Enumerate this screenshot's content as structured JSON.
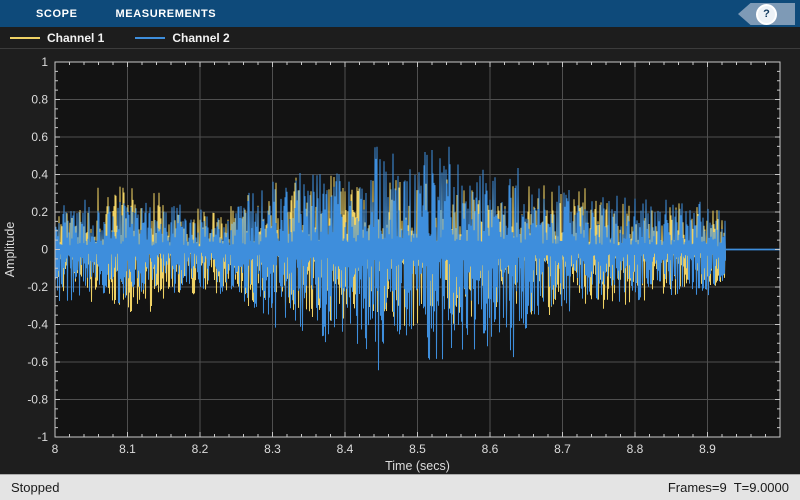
{
  "tab_bar": {
    "tabs": [
      {
        "label": "SCOPE"
      },
      {
        "label": "MEASUREMENTS"
      }
    ],
    "help_label": "?"
  },
  "legend": {
    "items": [
      {
        "label": "Channel 1",
        "color": "#F0D264"
      },
      {
        "label": "Channel 2",
        "color": "#3E8EDC"
      }
    ]
  },
  "status_bar": {
    "left": "Stopped",
    "right": "Frames=9  T=9.0000"
  },
  "colors": {
    "tab_bar_bg": "#0E4A7A",
    "help_banner": "#7E9AB6",
    "plot_bg": "#131313",
    "region_bg": "#1E1E1E",
    "grid": "#4F4F4F",
    "axis_border": "#C8C8C8",
    "tick_label": "#DCDCDC",
    "status_bg": "#E4E4E4",
    "channel1": "#F0D264",
    "channel2": "#3E8EDC"
  },
  "chart_data": {
    "type": "line",
    "title": "",
    "xlabel": "Time (secs)",
    "ylabel": "Amplitude",
    "xlim": [
      8,
      9
    ],
    "ylim": [
      -1,
      1
    ],
    "xticks": [
      8,
      8.1,
      8.2,
      8.3,
      8.4,
      8.5,
      8.6,
      8.7,
      8.8,
      8.9
    ],
    "xtick_labels": [
      "8",
      "8.1",
      "8.2",
      "8.3",
      "8.4",
      "8.5",
      "8.6",
      "8.7",
      "8.8",
      "8.9"
    ],
    "yticks": [
      -1,
      -0.8,
      -0.6,
      -0.4,
      -0.2,
      0,
      0.2,
      0.4,
      0.6,
      0.8,
      1
    ],
    "ytick_labels": [
      "-1",
      "-0.8",
      "-0.6",
      "-0.4",
      "-0.2",
      "0",
      "0.2",
      "0.4",
      "0.6",
      "0.8",
      "1"
    ],
    "x_minor_step": 0.02,
    "y_minor_step": 0.05,
    "grid": true,
    "legend_position": "top-strip",
    "signal_end_time": 8.925,
    "series": [
      {
        "name": "Channel 1",
        "color": "#F0D264",
        "description": "noisy speech waveform, peak-amplitude envelope vs time",
        "envelope": [
          [
            8.0,
            0.22
          ],
          [
            8.04,
            0.26
          ],
          [
            8.06,
            0.32
          ],
          [
            8.1,
            0.36
          ],
          [
            8.13,
            0.32
          ],
          [
            8.16,
            0.24
          ],
          [
            8.2,
            0.22
          ],
          [
            8.25,
            0.26
          ],
          [
            8.3,
            0.33
          ],
          [
            8.35,
            0.38
          ],
          [
            8.4,
            0.37
          ],
          [
            8.45,
            0.4
          ],
          [
            8.5,
            0.38
          ],
          [
            8.55,
            0.38
          ],
          [
            8.6,
            0.36
          ],
          [
            8.64,
            0.34
          ],
          [
            8.68,
            0.33
          ],
          [
            8.72,
            0.32
          ],
          [
            8.76,
            0.3
          ],
          [
            8.8,
            0.26
          ],
          [
            8.85,
            0.24
          ],
          [
            8.9,
            0.22
          ],
          [
            8.925,
            0.18
          ]
        ]
      },
      {
        "name": "Channel 2",
        "color": "#3E8EDC",
        "description": "noisy speech waveform, peak-amplitude envelope vs time",
        "envelope": [
          [
            8.0,
            0.3
          ],
          [
            8.03,
            0.26
          ],
          [
            8.06,
            0.27
          ],
          [
            8.1,
            0.28
          ],
          [
            8.14,
            0.24
          ],
          [
            8.17,
            0.23
          ],
          [
            8.2,
            0.21
          ],
          [
            8.24,
            0.25
          ],
          [
            8.28,
            0.3
          ],
          [
            8.31,
            0.42
          ],
          [
            8.34,
            0.46
          ],
          [
            8.38,
            0.5
          ],
          [
            8.41,
            0.46
          ],
          [
            8.45,
            0.56
          ],
          [
            8.48,
            0.46
          ],
          [
            8.51,
            0.5
          ],
          [
            8.55,
            0.54
          ],
          [
            8.58,
            0.5
          ],
          [
            8.61,
            0.48
          ],
          [
            8.63,
            0.5
          ],
          [
            8.65,
            0.38
          ],
          [
            8.67,
            0.3
          ],
          [
            8.69,
            0.34
          ],
          [
            8.71,
            0.3
          ],
          [
            8.74,
            0.26
          ],
          [
            8.78,
            0.27
          ],
          [
            8.82,
            0.27
          ],
          [
            8.86,
            0.25
          ],
          [
            8.9,
            0.25
          ],
          [
            8.92,
            0.2
          ],
          [
            8.925,
            0.18
          ]
        ]
      }
    ]
  }
}
